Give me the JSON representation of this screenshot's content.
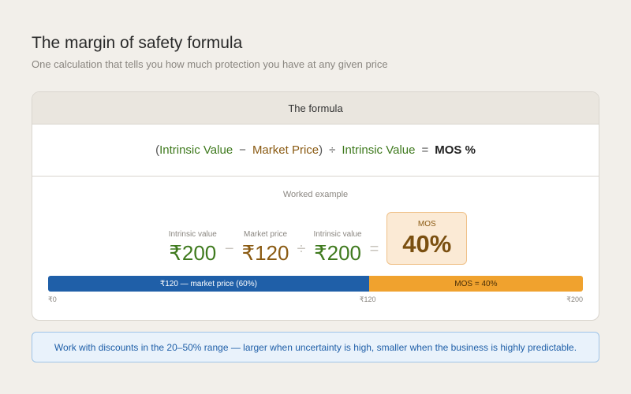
{
  "header": {
    "title": "The margin of safety formula",
    "subtitle": "One calculation that tells you how much protection you have at any given price"
  },
  "card": {
    "title": "The formula",
    "formula": {
      "open_paren": "(",
      "term1": "Intrinsic Value",
      "minus": "−",
      "term2": "Market Price",
      "close_paren": ")",
      "divide": "÷",
      "term3": "Intrinsic Value",
      "equals": "=",
      "result": "MOS %"
    },
    "worked_example": {
      "label": "Worked example",
      "intrinsic_label": "Intrinsic value",
      "intrinsic_value": "₹200",
      "minus": "−",
      "market_label": "Market price",
      "market_value": "₹120",
      "divide": "÷",
      "intrinsic2_label": "Intrinsic value",
      "intrinsic2_value": "₹200",
      "equals": "=",
      "mos_label": "MOS",
      "mos_value": "40%"
    },
    "bar": {
      "market_fraction": 0.6,
      "market_label": "₹120 — market price (60%)",
      "mos_label": "MOS = 40%",
      "tick_start": "₹0",
      "tick_mid": "₹120",
      "tick_end": "₹200",
      "colors": {
        "market": "#1f5fa8",
        "mos": "#f0a22e"
      }
    }
  },
  "note": "Work with discounts in the 20–50% range — larger when uncertainty is high, smaller when the business is highly predictable."
}
